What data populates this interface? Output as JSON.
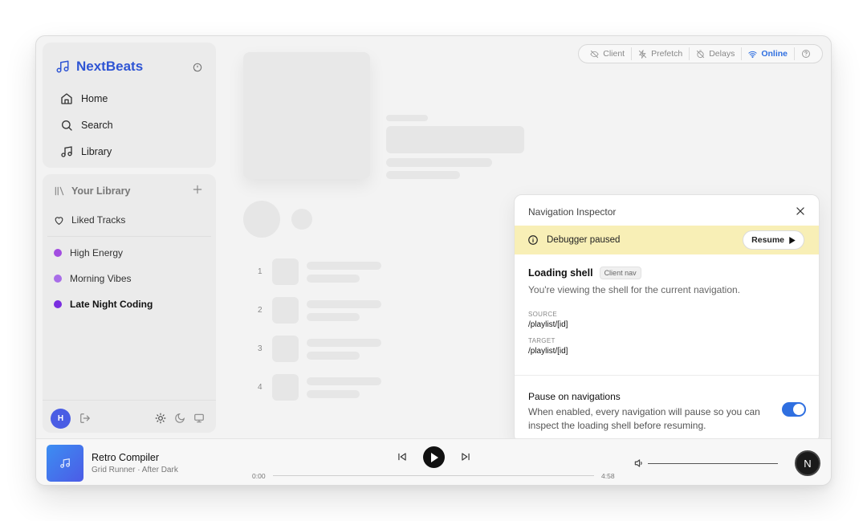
{
  "brand": {
    "name": "NextBeats",
    "icon": "music-note-icon"
  },
  "nav": {
    "items": [
      {
        "label": "Home",
        "icon": "home-icon"
      },
      {
        "label": "Search",
        "icon": "search-icon"
      },
      {
        "label": "Library",
        "icon": "music-note-icon"
      }
    ]
  },
  "library": {
    "title": "Your Library",
    "liked": "Liked Tracks",
    "playlists": [
      {
        "label": "High Energy",
        "color": "#a24de0",
        "active": false
      },
      {
        "label": "Morning Vibes",
        "color": "#a24de0",
        "active": false
      },
      {
        "label": "Late Night Coding",
        "color": "#7a2ee0",
        "active": true
      }
    ],
    "user_initial": "H"
  },
  "statusbar": {
    "items": [
      {
        "label": "Client",
        "icon": "eye-off-icon"
      },
      {
        "label": "Prefetch",
        "icon": "bolt-off-icon"
      },
      {
        "label": "Delays",
        "icon": "timer-off-icon"
      },
      {
        "label": "Online",
        "icon": "wifi-icon",
        "active": true
      }
    ]
  },
  "tracklist": {
    "numbers": [
      "1",
      "2",
      "3",
      "4"
    ]
  },
  "inspector": {
    "title": "Navigation Inspector",
    "banner": "Debugger paused",
    "resume_label": "Resume",
    "heading": "Loading shell",
    "tag": "Client nav",
    "description": "You're viewing the shell for the current navigation.",
    "source_label": "SOURCE",
    "source_value": "/playlist/[id]",
    "target_label": "TARGET",
    "target_value": "/playlist/[id]",
    "pause_title": "Pause on navigations",
    "pause_desc": "When enabled, every navigation will pause so you can inspect the loading shell before resuming.",
    "toggle_on": true,
    "accent": "#2f6fe0",
    "banner_color": "#f8efb6"
  },
  "player": {
    "title": "Retro Compiler",
    "subtitle": "Grid Runner · After Dark",
    "current_time": "0:00",
    "duration": "4:58",
    "progress": 0,
    "badge": "N"
  }
}
